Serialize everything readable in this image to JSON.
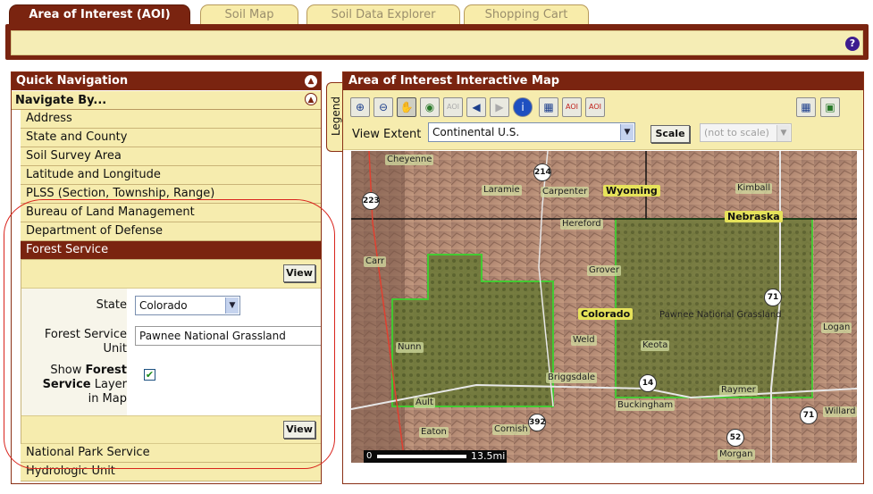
{
  "tabs": [
    {
      "label": "Area of Interest (AOI)",
      "active": true
    },
    {
      "label": "Soil Map",
      "active": false
    },
    {
      "label": "Soil Data Explorer",
      "active": false
    },
    {
      "label": "Shopping Cart",
      "active": false
    }
  ],
  "help_glyph": "?",
  "quick_nav": {
    "title": "Quick Navigation",
    "navigate_by": "Navigate By...",
    "items": [
      "Address",
      "State and County",
      "Soil Survey Area",
      "Latitude and Longitude",
      "PLSS (Section, Township, Range)",
      "Bureau of Land Management",
      "Department of Defense",
      "Forest Service"
    ],
    "after_items": [
      "National Park Service",
      "Hydrologic Unit"
    ],
    "view_label": "View",
    "form": {
      "state_label": "State",
      "state_value": "Colorado",
      "unit_label_1": "Forest Service",
      "unit_label_2": "Unit",
      "unit_value": "Pawnee National Grassland",
      "show_label_1": "Show",
      "show_label_bold_1": "Forest",
      "show_label_bold_2": "Service",
      "show_label_3": "Layer",
      "show_label_4": "in Map",
      "show_checked": true
    }
  },
  "map": {
    "title": "Area of Interest Interactive Map",
    "legend_tab": "Legend",
    "view_extent_label": "View Extent",
    "view_extent_value": "Continental U.S.",
    "scale_button": "Scale",
    "scale_value": "(not to scale)",
    "tools": [
      "zoom-in",
      "zoom-out",
      "pan",
      "globe",
      "aoi-disabled",
      "back",
      "forward",
      "identify",
      "grid",
      "define-aoi-rect",
      "define-aoi-polygon"
    ],
    "towns": [
      "Cheyenne",
      "Laramie",
      "Carpenter",
      "Kimball",
      "Hereford",
      "Carr",
      "Grover",
      "Nunn",
      "Weld",
      "Keota",
      "Logan",
      "Ault",
      "Briggsdale",
      "Raymer",
      "Buckingham",
      "Eaton",
      "Cornish",
      "Willard",
      "Morgan",
      "Pawnee National Grassland"
    ],
    "states": [
      "Wyoming",
      "Nebraska",
      "Colorado"
    ],
    "shields": [
      "214",
      "223",
      "71",
      "14",
      "392",
      "71",
      "52"
    ],
    "scalebar_zero": "0",
    "scalebar_text": "13.5mi"
  },
  "colors": {
    "brand": "#7a2410",
    "panel_bg": "#f6ecae",
    "highlight": "#d9231c",
    "boundary": "#39d22d"
  }
}
